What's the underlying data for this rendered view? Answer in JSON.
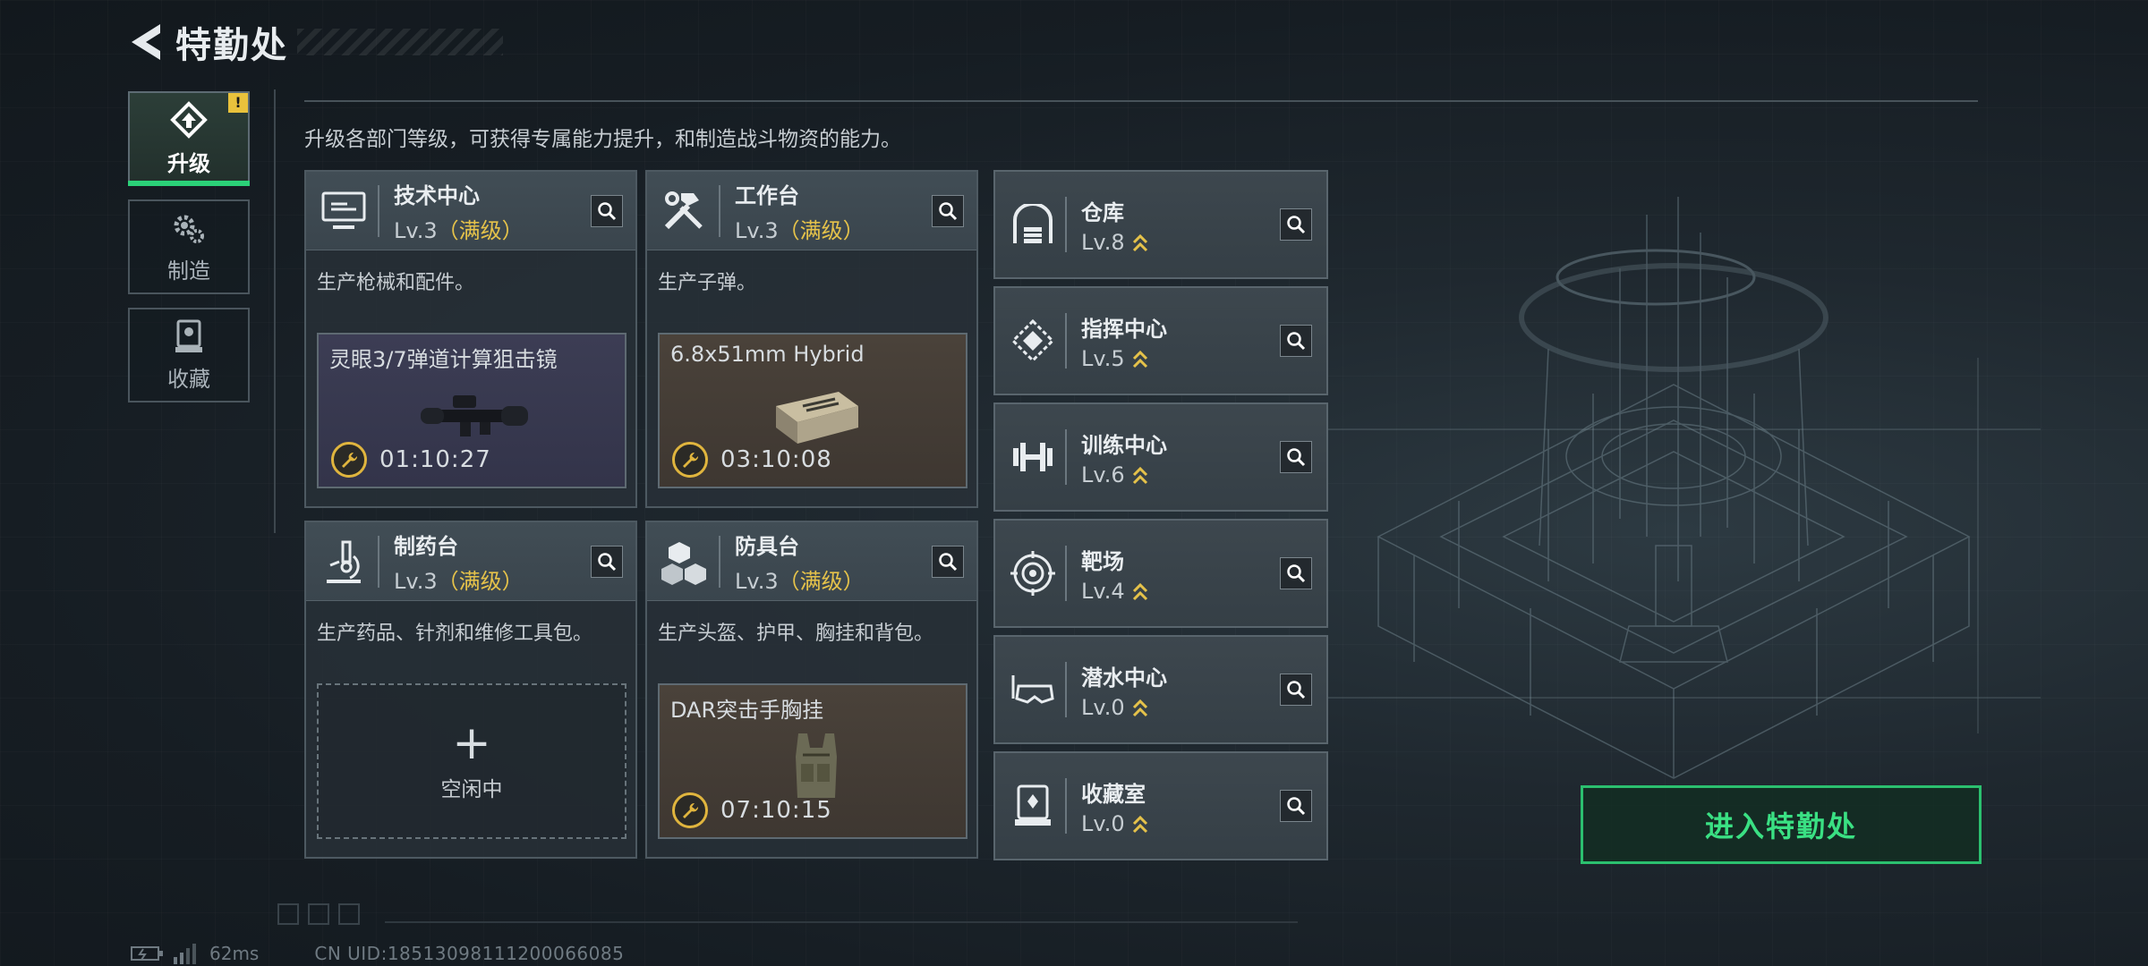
{
  "header": {
    "title": "特勤处"
  },
  "nav": [
    {
      "id": "upgrade",
      "label": "升级",
      "active": true,
      "badge": "!"
    },
    {
      "id": "craft",
      "label": "制造"
    },
    {
      "id": "collect",
      "label": "收藏"
    }
  ],
  "description": "升级各部门等级，可获得专属能力提升，和制造战斗物资的能力。",
  "cards": [
    {
      "name": "技术中心",
      "level": "Lv.3",
      "max_label": "（满级）",
      "desc": "生产枪械和配件。",
      "slot": {
        "item": "灵眼3/7弹道计算狙击镜",
        "timer": "01:10:27",
        "tone": "purple"
      }
    },
    {
      "name": "工作台",
      "level": "Lv.3",
      "max_label": "（满级）",
      "desc": "生产子弹。",
      "slot": {
        "item": "6.8x51mm Hybrid",
        "timer": "03:10:08",
        "tone": "brown"
      }
    },
    {
      "name": "制药台",
      "level": "Lv.3",
      "max_label": "（满级）",
      "desc": "生产药品、针剂和维修工具包。",
      "slot": {
        "empty": true,
        "plus": "+",
        "label": "空闲中"
      }
    },
    {
      "name": "防具台",
      "level": "Lv.3",
      "max_label": "（满级）",
      "desc": "生产头盔、护甲、胸挂和背包。",
      "slot": {
        "item": "DAR突击手胸挂",
        "timer": "07:10:15",
        "tone": "brown"
      }
    }
  ],
  "small_cards": [
    {
      "name": "仓库",
      "level": "Lv.8",
      "icon": "warehouse-icon"
    },
    {
      "name": "指挥中心",
      "level": "Lv.5",
      "icon": "command-icon"
    },
    {
      "name": "训练中心",
      "level": "Lv.6",
      "icon": "dumbbell-icon"
    },
    {
      "name": "靶场",
      "level": "Lv.4",
      "icon": "target-icon"
    },
    {
      "name": "潜水中心",
      "level": "Lv.0",
      "icon": "diving-mask-icon"
    },
    {
      "name": "收藏室",
      "level": "Lv.0",
      "icon": "collection-icon"
    }
  ],
  "enter_button": "进入特勤处",
  "status": {
    "ping": "62ms",
    "uid": "CN UID:18513098111200066085"
  },
  "colors": {
    "accent_green": "#2bd178",
    "gold": "#e5c24a",
    "badge_yellow": "#e9c23c"
  }
}
